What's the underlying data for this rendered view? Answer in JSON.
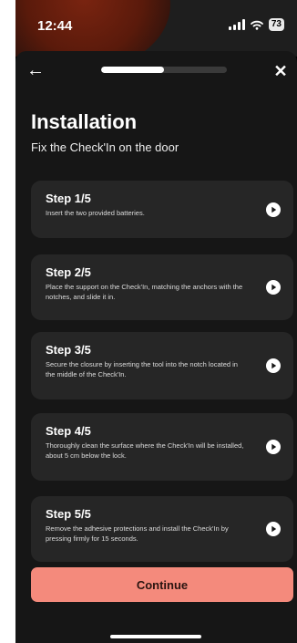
{
  "status_bar": {
    "time": "12:44",
    "battery": "73"
  },
  "progress": {
    "fraction": 0.5
  },
  "header": {
    "back_icon": "arrow-left-icon",
    "close_icon": "close-icon"
  },
  "page": {
    "title": "Installation",
    "subtitle": "Fix the Check'In on the door"
  },
  "steps": [
    {
      "title": "Step 1/5",
      "description": "Insert the two provided batteries."
    },
    {
      "title": "Step 2/5",
      "description": "Place the support on the Check'In, matching the anchors with the notches, and slide it in."
    },
    {
      "title": "Step 3/5",
      "description": "Secure the closure by inserting the tool into the notch located in the middle of the Check'In."
    },
    {
      "title": "Step 4/5",
      "description": "Thoroughly clean the surface where the Check'In will be installed, about 5 cm below the lock."
    },
    {
      "title": "Step 5/5",
      "description": "Remove the adhesive protections and install the Check'In by pressing firmly for 15 seconds."
    }
  ],
  "continue_label": "Continue",
  "colors": {
    "accent": "#f48a7c",
    "card": "#262626",
    "background": "#161616"
  }
}
